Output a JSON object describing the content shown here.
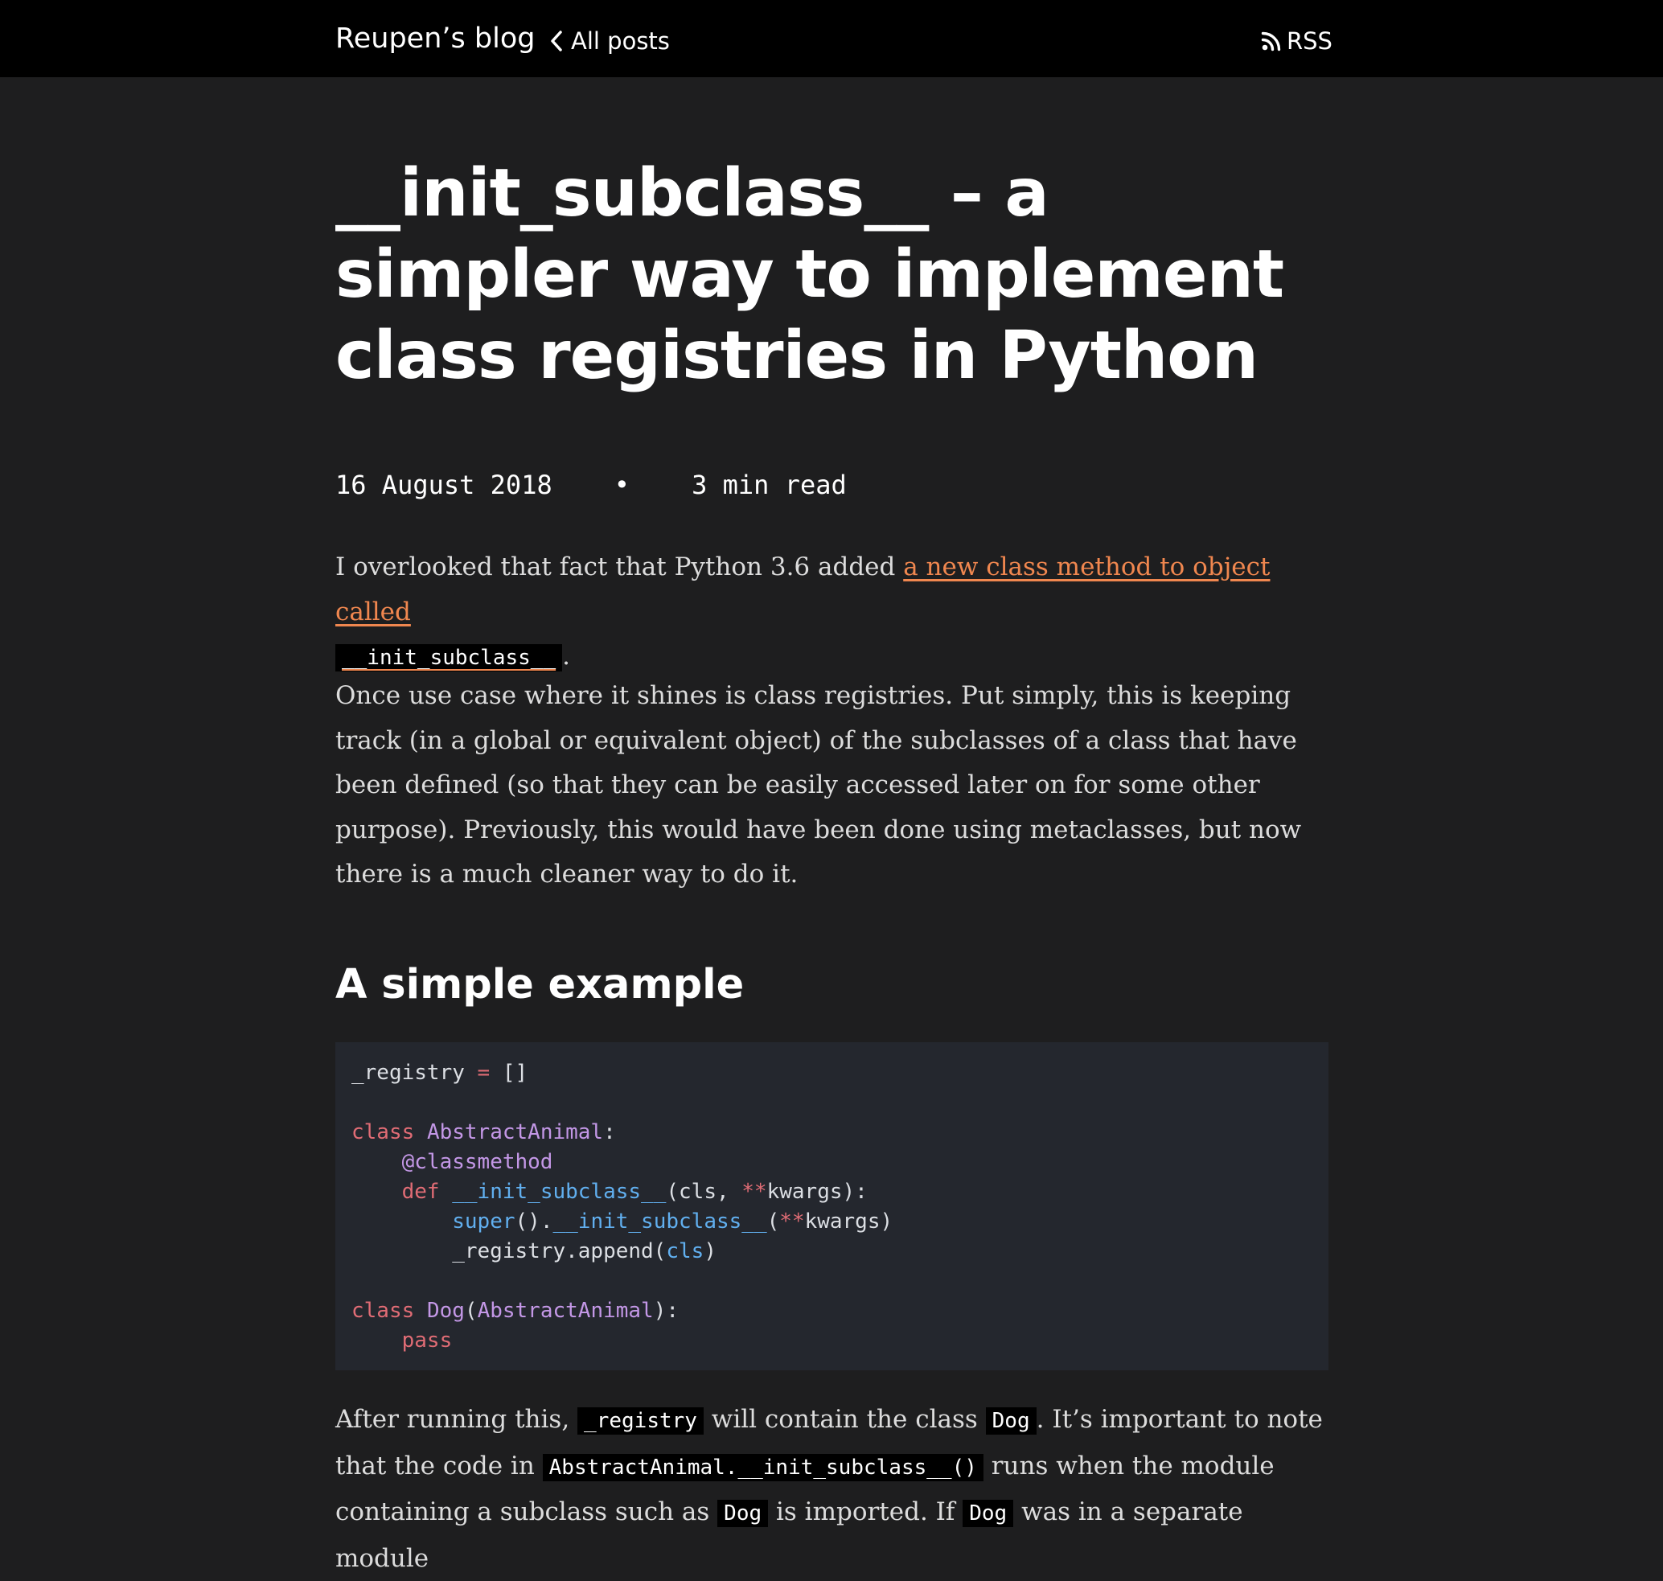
{
  "header": {
    "brand": "Reupen’s blog",
    "all_posts": "All posts",
    "rss": "RSS"
  },
  "post": {
    "title": "__init_subclass__ – a simpler way to implement class registries in Python",
    "date": "16 August 2018",
    "separator": "•",
    "read_time": "3 min read",
    "p1": {
      "text_before": "I overlooked that fact that Python 3.6 added ",
      "link_text": "a new class method to object called",
      "link_code": "__init_subclass__",
      "text_after": "."
    },
    "p2": "Once use case where it shines is class registries. Put simply, this is keeping track (in a global or equivalent object) of the subclasses of a class that have been defined (so that they can be easily accessed later on for some other purpose). Previously, this would have been done using metaclasses, but now there is a much cleaner way to do it.",
    "h2": "A simple example",
    "code": {
      "l1": [
        "_registry ",
        "=",
        " []"
      ],
      "l3": [
        "class",
        " ",
        "AbstractAnimal",
        ":"
      ],
      "l4": [
        "    ",
        "@classmethod"
      ],
      "l5": [
        "    ",
        "def",
        " ",
        "__init_subclass__",
        "(cls, ",
        "**",
        "kwargs):"
      ],
      "l6": [
        "        ",
        "super",
        "().",
        "__init_subclass__",
        "(",
        "**",
        "kwargs)"
      ],
      "l7": [
        "        _registry.append(",
        "cls",
        ")"
      ],
      "l9": [
        "class",
        " ",
        "Dog",
        "(",
        "AbstractAnimal",
        "):"
      ],
      "l10": [
        "    ",
        "pass"
      ]
    },
    "p3": {
      "t1": "After running this, ",
      "c1": "_registry",
      "t2": " will contain the class ",
      "c2": "Dog",
      "t3": ". It’s important to note that the code in ",
      "c3": "AbstractAnimal.__init_subclass__()",
      "t4": " runs when the module containing a subclass such as ",
      "c4": "Dog",
      "t5": " is imported. If ",
      "c5": "Dog",
      "t6": " was in a separate module"
    }
  }
}
